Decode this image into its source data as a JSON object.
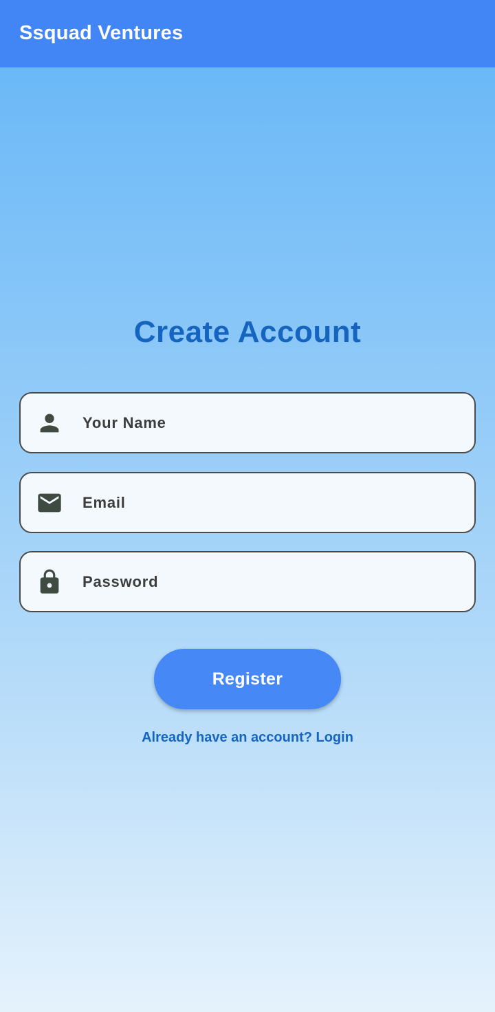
{
  "app_bar": {
    "title": "Ssquad Ventures",
    "color": "#4285f4"
  },
  "form": {
    "heading": "Create Account",
    "fields": [
      {
        "icon": "person-icon",
        "placeholder": "Your Name",
        "value": ""
      },
      {
        "icon": "email-icon",
        "placeholder": "Email",
        "value": ""
      },
      {
        "icon": "lock-icon",
        "placeholder": "Password",
        "value": ""
      }
    ],
    "register_label": "Register",
    "login_link": "Already have an account? Login"
  },
  "colors": {
    "accent": "#1565c0",
    "button": "#4688f6",
    "field_background": "#f4f9fd"
  }
}
